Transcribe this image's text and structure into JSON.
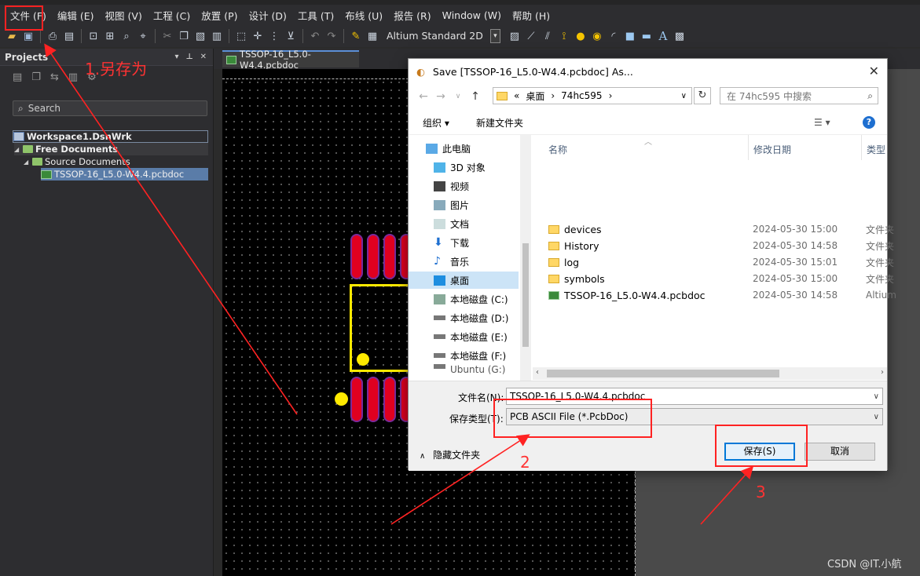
{
  "menu": [
    "文件 (F)",
    "编辑 (E)",
    "视图 (V)",
    "工程 (C)",
    "放置 (P)",
    "设计 (D)",
    "工具 (T)",
    "布线 (U)",
    "报告 (R)",
    "Window (W)",
    "帮助 (H)"
  ],
  "toolbar": {
    "view_mode": "Altium Standard 2D"
  },
  "projects": {
    "title": "Projects",
    "search_placeholder": "Search",
    "tree": {
      "workspace": "Workspace1.DsnWrk",
      "free_documents": "Free Documents",
      "source_documents": "Source Documents",
      "file": "TSSOP-16_L5.0-W4.4.pcbdoc"
    }
  },
  "doc_tab": "TSSOP-16_L5.0-W4.4.pcbdoc",
  "dialog": {
    "title": "Save [TSSOP-16_L5.0-W4.4.pcbdoc] As...",
    "path": {
      "prefix": "«",
      "segments": [
        "桌面",
        "74hc595"
      ]
    },
    "search_placeholder": "在 74hc595 中搜索",
    "organize": "组织 ▾",
    "new_folder": "新建文件夹",
    "nav_items": [
      "此电脑",
      "3D 对象",
      "视频",
      "图片",
      "文档",
      "下载",
      "音乐",
      "桌面",
      "本地磁盘 (C:)",
      "本地磁盘 (D:)",
      "本地磁盘 (E:)",
      "本地磁盘 (F:)",
      "Ubuntu (G:)"
    ],
    "columns": {
      "name": "名称",
      "date": "修改日期",
      "type": "类型"
    },
    "files": [
      {
        "name": "devices",
        "date": "2024-05-30 15:00",
        "type": "文件夹",
        "kind": "folder"
      },
      {
        "name": "History",
        "date": "2024-05-30 14:58",
        "type": "文件夹",
        "kind": "folder"
      },
      {
        "name": "log",
        "date": "2024-05-30 15:01",
        "type": "文件夹",
        "kind": "folder"
      },
      {
        "name": "symbols",
        "date": "2024-05-30 15:00",
        "type": "文件夹",
        "kind": "folder"
      },
      {
        "name": "TSSOP-16_L5.0-W4.4.pcbdoc",
        "date": "2024-05-30 14:58",
        "type": "Altium",
        "kind": "pcb"
      }
    ],
    "filename_label": "文件名(N):",
    "filename_value": "TSSOP-16_L5.0-W4.4.pcbdoc",
    "filetype_label": "保存类型(T):",
    "filetype_value": "PCB ASCII File (*.PcbDoc)",
    "hide_folders": "隐藏文件夹",
    "save_button": "保存(S)",
    "cancel_button": "取消"
  },
  "annotations": {
    "step1": "1.另存为",
    "step2": "2",
    "step3": "3",
    "color": "#ff2222"
  },
  "watermark": "CSDN @IT.小航"
}
